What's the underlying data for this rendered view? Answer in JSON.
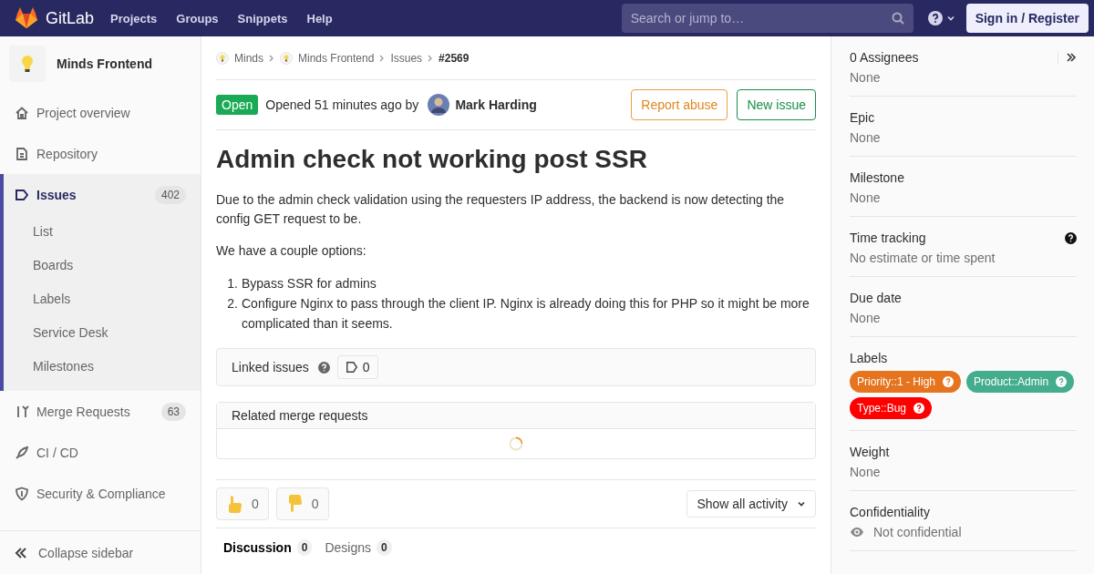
{
  "navbar": {
    "brand": "GitLab",
    "links": [
      "Projects",
      "Groups",
      "Snippets",
      "Help"
    ],
    "search": {
      "placeholder": "Search or jump to…"
    },
    "sign_in": "Sign in / Register"
  },
  "sidebar": {
    "project": "Minds Frontend",
    "items": [
      {
        "label": "Project overview",
        "selected": false
      },
      {
        "label": "Repository",
        "selected": false
      },
      {
        "label": "Issues",
        "count": "402",
        "selected": true,
        "children": [
          {
            "label": "List",
            "selected": false
          },
          {
            "label": "Boards",
            "selected": false
          },
          {
            "label": "Labels",
            "selected": false
          },
          {
            "label": "Service Desk",
            "selected": false
          },
          {
            "label": "Milestones",
            "selected": false
          }
        ]
      },
      {
        "label": "Merge Requests",
        "count": "63",
        "selected": false
      },
      {
        "label": "CI / CD",
        "selected": false
      },
      {
        "label": "Security & Compliance",
        "selected": false
      }
    ],
    "collapse": "Collapse sidebar"
  },
  "breadcrumbs": [
    {
      "label": "Minds",
      "avatar": true
    },
    {
      "label": "Minds Frontend",
      "avatar": true
    },
    {
      "label": "Issues",
      "avatar": false
    },
    {
      "label": "#2569",
      "avatar": false
    }
  ],
  "issue": {
    "status": "Open",
    "opened": "Opened 51 minutes ago by",
    "author": "Mark Harding",
    "buttons": [
      {
        "label": "Report abuse",
        "kind": "warning"
      },
      {
        "label": "New issue",
        "kind": "success"
      }
    ],
    "title": "Admin check not working post SSR",
    "paragraphs": [
      "Due to the admin check validation using the requesters IP address, the backend is now detecting the config GET request to be.",
      "We have a couple options:"
    ],
    "list": [
      {
        "marker": "1.",
        "text": "Bypass SSR for admins"
      },
      {
        "marker": "2.",
        "text": "Configure Nginx to pass through the client IP. Nginx is already doing this for PHP so it might be more complicated than it seems."
      }
    ],
    "linked_issues": {
      "label": "Linked issues",
      "count": "0"
    },
    "related_mrs": {
      "title": "Related merge requests"
    },
    "awards": [
      {
        "kind": "thumbsup",
        "count": "0"
      },
      {
        "kind": "thumbsdown",
        "count": "0"
      }
    ],
    "activity_filter": "Show all activity",
    "tabs": [
      {
        "label": "Discussion",
        "count": "0",
        "selected": true
      },
      {
        "label": "Designs",
        "count": "0",
        "selected": false
      }
    ]
  },
  "right_sidebar": {
    "blocks": [
      {
        "kind": "text",
        "title": "0 Assignees",
        "value": "None",
        "collapse": true
      },
      {
        "kind": "text",
        "title": "Epic",
        "value": "None"
      },
      {
        "kind": "text",
        "title": "Milestone",
        "value": "None"
      },
      {
        "kind": "text",
        "title": "Time tracking",
        "value": "No estimate or time spent",
        "help": true
      },
      {
        "kind": "text",
        "title": "Due date",
        "value": "None"
      },
      {
        "kind": "labels",
        "title": "Labels",
        "labels": [
          {
            "label": "Priority::1 - High",
            "color": "#e6741f"
          },
          {
            "label": "Product::Admin",
            "color": "#44ad8e"
          },
          {
            "label": "Type::Bug",
            "color": "#ff0000"
          }
        ]
      },
      {
        "kind": "text",
        "title": "Weight",
        "value": "None"
      },
      {
        "kind": "eye",
        "title": "Confidentiality",
        "value": "Not confidential"
      }
    ]
  }
}
